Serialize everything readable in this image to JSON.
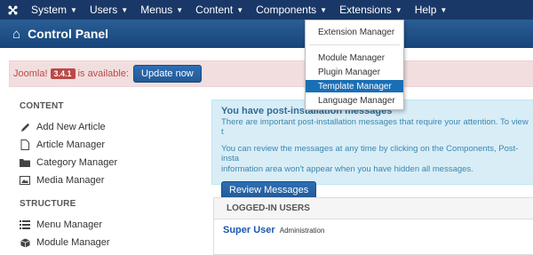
{
  "topnav": {
    "menu": [
      {
        "label": "System"
      },
      {
        "label": "Users"
      },
      {
        "label": "Menus"
      },
      {
        "label": "Content"
      },
      {
        "label": "Components"
      },
      {
        "label": "Extensions"
      },
      {
        "label": "Help"
      }
    ]
  },
  "header": {
    "title": "Control Panel"
  },
  "alert": {
    "prefix": "Joomla!",
    "version": "3.4.1",
    "suffix": "is available:",
    "button": "Update now"
  },
  "dropdown": {
    "items": [
      {
        "label": "Extension Manager"
      },
      {
        "label": "Module Manager"
      },
      {
        "label": "Plugin Manager"
      },
      {
        "label": "Template Manager"
      },
      {
        "label": "Language Manager"
      }
    ]
  },
  "sidebar": {
    "content_heading": "CONTENT",
    "content_items": [
      {
        "label": "Add New Article",
        "icon": "pencil-icon"
      },
      {
        "label": "Article Manager",
        "icon": "file-icon"
      },
      {
        "label": "Category Manager",
        "icon": "folder-icon"
      },
      {
        "label": "Media Manager",
        "icon": "image-icon"
      }
    ],
    "structure_heading": "STRUCTURE",
    "structure_items": [
      {
        "label": "Menu Manager",
        "icon": "list-icon"
      },
      {
        "label": "Module Manager",
        "icon": "cube-icon"
      }
    ]
  },
  "info": {
    "title": "You have post-installation messages",
    "line1": "There are important post-installation messages that require your attention. To view t",
    "line2": "You can review the messages at any time by clicking on the Components, Post-insta",
    "line3": "information area won't appear when you have hidden all messages.",
    "button": "Review Messages"
  },
  "users": {
    "heading": "LOGGED-IN USERS",
    "name": "Super User",
    "role": "Administration"
  },
  "colors": {
    "nav": "#1a3867",
    "header": "#1d4f87",
    "alert_bg": "#f2dede",
    "info_bg": "#d9edf7",
    "active_item": "#1a6fb4"
  }
}
